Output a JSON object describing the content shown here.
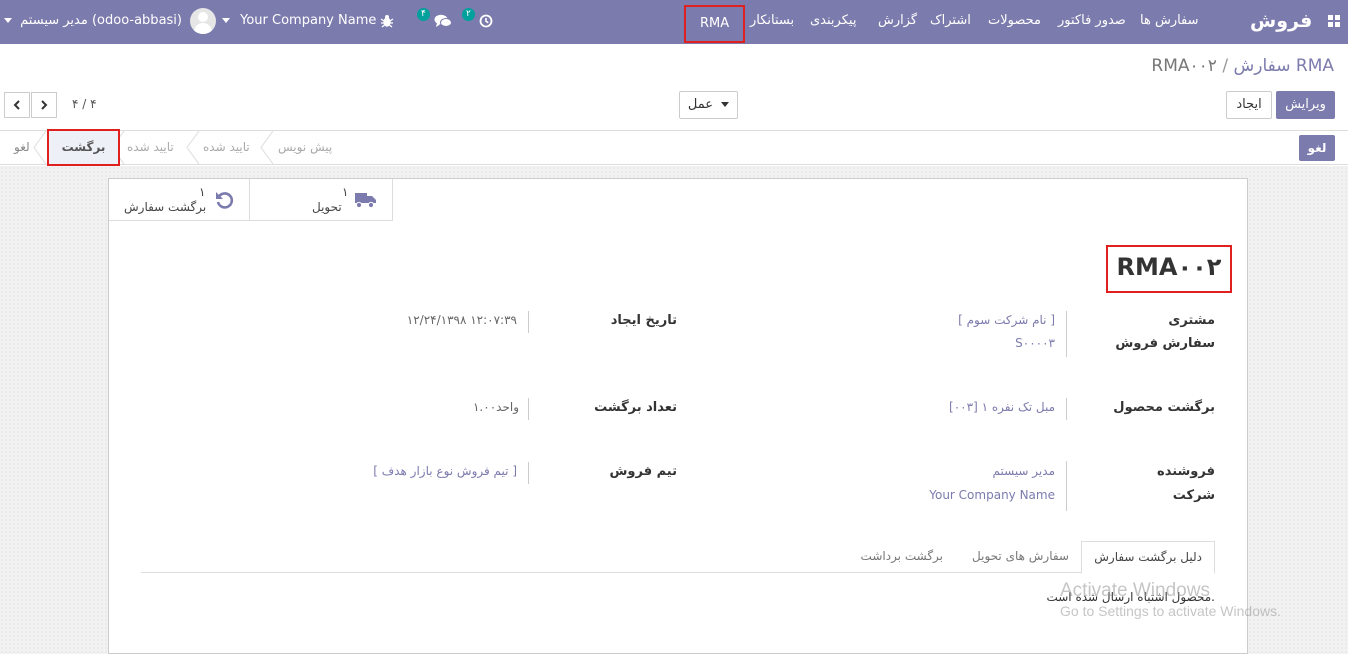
{
  "navbar": {
    "apps_icon": "grid-icon",
    "brand": "فروش",
    "menu": [
      "سفارش ها",
      "صدور فاکتور",
      "محصولات",
      "اشتراک",
      "گزارش",
      "پیکربندی",
      "بستانکار",
      "RMA"
    ],
    "activity_badge": "۲",
    "messages_badge": "۴",
    "company": "Your Company Name",
    "user": "مدیر سیستم (odoo-abbasi)"
  },
  "control_panel": {
    "breadcrumb_parent": "سفارش RMA",
    "breadcrumb_sep": "/",
    "breadcrumb_current": "RMA۰۰۲",
    "edit_label": "ویرایش",
    "create_label": "ایجاد",
    "action_label": "عمل",
    "pager": "۴ / ۴"
  },
  "statusbar": {
    "cancel_button": "لغو",
    "stages": [
      "پیش نویس",
      "تایید شده",
      "تایید شده",
      "برگشت",
      "لغو"
    ],
    "active_stage": "برگشت"
  },
  "smart_buttons": {
    "delivery_count": "۱",
    "delivery_label": "تحویل",
    "return_count": "۱",
    "return_label": "برگشت سفارش"
  },
  "form": {
    "title": "RMA۰۰۲",
    "customer_label": "مشتری",
    "customer_value": "[ نام شرکت سوم ]",
    "sale_order_label": "سفارش فروش",
    "sale_order_value": "S۰۰۰۰۳",
    "create_date_label": "تاریخ ایجاد",
    "create_date_value": "۱۲/۲۴/۱۳۹۸ ۱۲:۰۷:۳۹",
    "return_product_label": "برگشت محصول",
    "return_product_value": "[۰۰۳] مبل تک نفره ۱",
    "return_qty_label": "تعداد برگشت",
    "return_qty_value": "۱.۰۰واحد",
    "salesperson_label": "فروشنده",
    "salesperson_value": "مدیر سیستم",
    "company_label": "شرکت",
    "company_value": "Your Company Name",
    "sales_team_label": "تیم فروش",
    "sales_team_value": "[ تیم فروش نوع بازار هدف ]"
  },
  "tabs": {
    "items": [
      "دلیل برگشت سفارش",
      "سفارش های تحویل",
      "برگشت برداشت"
    ],
    "content": "محصول اشتباه ارسال شده است."
  },
  "watermark": {
    "line1": "Activate Windows",
    "line2": "Go to Settings to activate Windows."
  },
  "colors": {
    "primary": "#7c7bad",
    "highlight": "#e0201f"
  }
}
